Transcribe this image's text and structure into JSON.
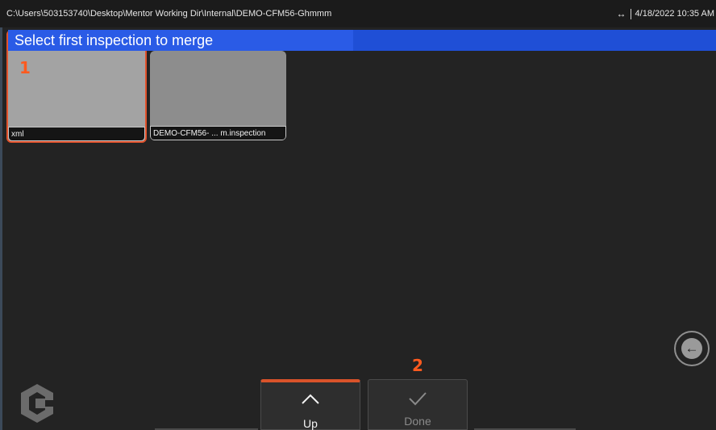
{
  "status_bar": {
    "path": "C:\\Users\\503153740\\Desktop\\Mentor Working Dir\\Internal\\DEMO-CFM56-Ghmmm",
    "link_icon": "↔",
    "datetime": "4/18/2022 10:35 AM"
  },
  "prompt": {
    "text": "Select first inspection to merge"
  },
  "files": [
    {
      "caption": "xml",
      "selected": true
    },
    {
      "caption": "DEMO-CFM56- ... m.inspection",
      "selected": false
    }
  ],
  "markers": {
    "first": "1",
    "second": "2"
  },
  "toolbar": {
    "up_label": "Up",
    "up_icon": "chevron-up-icon",
    "done_label": "Done",
    "done_icon": "checkmark-icon",
    "active_color": "#d9532a"
  },
  "back_icon": "back-arrow-icon",
  "colors": {
    "banner": "#1f4fd6",
    "marker": "#ff5a1f",
    "background": "#232323"
  }
}
